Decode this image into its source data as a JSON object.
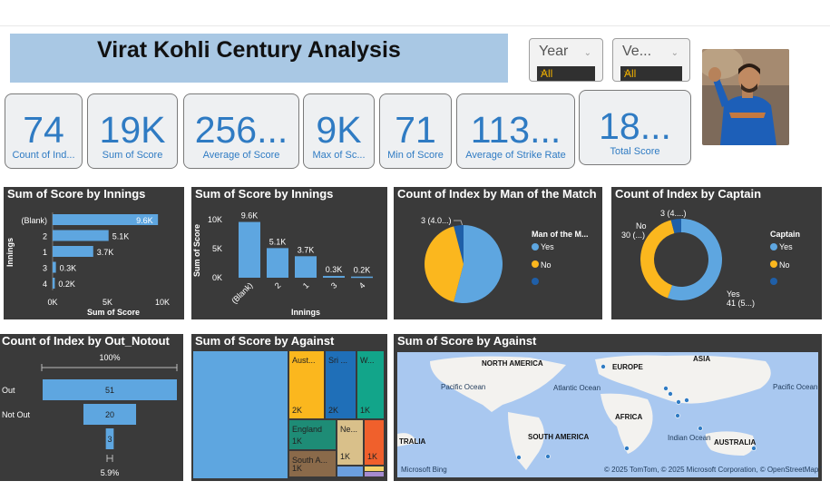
{
  "title": "Virat Kohli Century Analysis",
  "slicers": [
    {
      "label": "Year",
      "value": "All"
    },
    {
      "label": "Ve...",
      "value": "All"
    }
  ],
  "kpis": [
    {
      "value": "74",
      "label": "Count of Ind..."
    },
    {
      "value": "19K",
      "label": "Sum of Score"
    },
    {
      "value": "256...",
      "label": "Average of Score"
    },
    {
      "value": "9K",
      "label": "Max of Sc..."
    },
    {
      "value": "71",
      "label": "Min of Score"
    },
    {
      "value": "113...",
      "label": "Average of Strike Rate"
    },
    {
      "value": "18...",
      "label": "Total Score"
    }
  ],
  "colors": {
    "accent": "#2f7bc3",
    "bar": "#5ea6e0",
    "panel": "#3a3a3a",
    "yellow": "#fbb71e",
    "map_water": "#a9c8f0"
  },
  "chart_data": [
    {
      "type": "bar",
      "orientation": "horizontal",
      "title": "Sum of Score by Innings",
      "ylabel": "Innings",
      "xlabel": "Sum of Score",
      "categories": [
        "(Blank)",
        "2",
        "1",
        "3",
        "4"
      ],
      "values": [
        9600,
        5100,
        3700,
        300,
        200
      ],
      "labels": [
        "9.6K",
        "5.1K",
        "3.7K",
        "0.3K",
        "0.2K"
      ],
      "x_ticks": [
        "0K",
        "5K",
        "10K"
      ],
      "xlim": [
        0,
        10000
      ]
    },
    {
      "type": "bar",
      "orientation": "vertical",
      "title": "Sum of Score by Innings",
      "ylabel": "Sum of Score",
      "xlabel": "Innings",
      "categories": [
        "(Blank)",
        "2",
        "1",
        "3",
        "4"
      ],
      "values": [
        9600,
        5100,
        3700,
        300,
        200
      ],
      "labels": [
        "9.6K",
        "5.1K",
        "3.7K",
        "0.3K",
        "0.2K"
      ],
      "y_ticks": [
        "0K",
        "5K",
        "10K"
      ],
      "ylim": [
        0,
        10000
      ]
    },
    {
      "type": "pie",
      "title": "Count of Index by Man of the Match",
      "legend_title": "Man of the M...",
      "legend": [
        "Yes",
        "No",
        ""
      ],
      "values": [
        40,
        31,
        3
      ],
      "colors": [
        "#5ea6e0",
        "#fbb71e",
        "#1f5fa8"
      ],
      "callout": "3 (4.0...)"
    },
    {
      "type": "donut",
      "title": "Count of Index by Captain",
      "legend_title": "Captain",
      "legend": [
        "Yes",
        "No",
        ""
      ],
      "values": [
        41,
        30,
        3
      ],
      "colors": [
        "#5ea6e0",
        "#fbb71e",
        "#1f5fa8"
      ],
      "callouts": [
        "3 (4....)",
        "No",
        "30 (...)",
        "Yes",
        "41 (5...)"
      ]
    },
    {
      "type": "funnel",
      "title": "Count of Index by Out_Notout",
      "categories": [
        "Out",
        "Not Out",
        ""
      ],
      "values": [
        51,
        20,
        3
      ],
      "top_label": "100%",
      "bottom_label": "5.9%"
    },
    {
      "type": "treemap",
      "title": "Sum of Score by Against",
      "tiles": [
        {
          "label": "",
          "value": "",
          "color": "#5ea6e0"
        },
        {
          "label": "Aust...",
          "value": "2K",
          "color": "#fbb71e"
        },
        {
          "label": "Sri ...",
          "value": "2K",
          "color": "#1f6fb8"
        },
        {
          "label": "W...",
          "value": "1K",
          "color": "#12a58a"
        },
        {
          "label": "England",
          "value": "1K",
          "color": "#1e8c76"
        },
        {
          "label": "Ne...",
          "value": "1K",
          "color": "#d9c08a"
        },
        {
          "label": "",
          "value": "1K",
          "color": "#f0602c"
        },
        {
          "label": "South A...",
          "value": "1K",
          "color": "#8a6a4a"
        }
      ]
    },
    {
      "type": "map",
      "title": "Sum of Score by Against",
      "regions": [
        "NORTH AMERICA",
        "EUROPE",
        "ASIA",
        "AFRICA",
        "SOUTH AMERICA",
        "TRALIA",
        "AUSTRALIA"
      ],
      "oceans": [
        "Pacific Ocean",
        "Atlantic Ocean",
        "Indian Ocean",
        "Pacific Ocean"
      ],
      "attribution": "© 2025 TomTom, © 2025 Microsoft Corporation, © OpenStreetMap  Terms",
      "logo": "Microsoft Bing"
    }
  ]
}
